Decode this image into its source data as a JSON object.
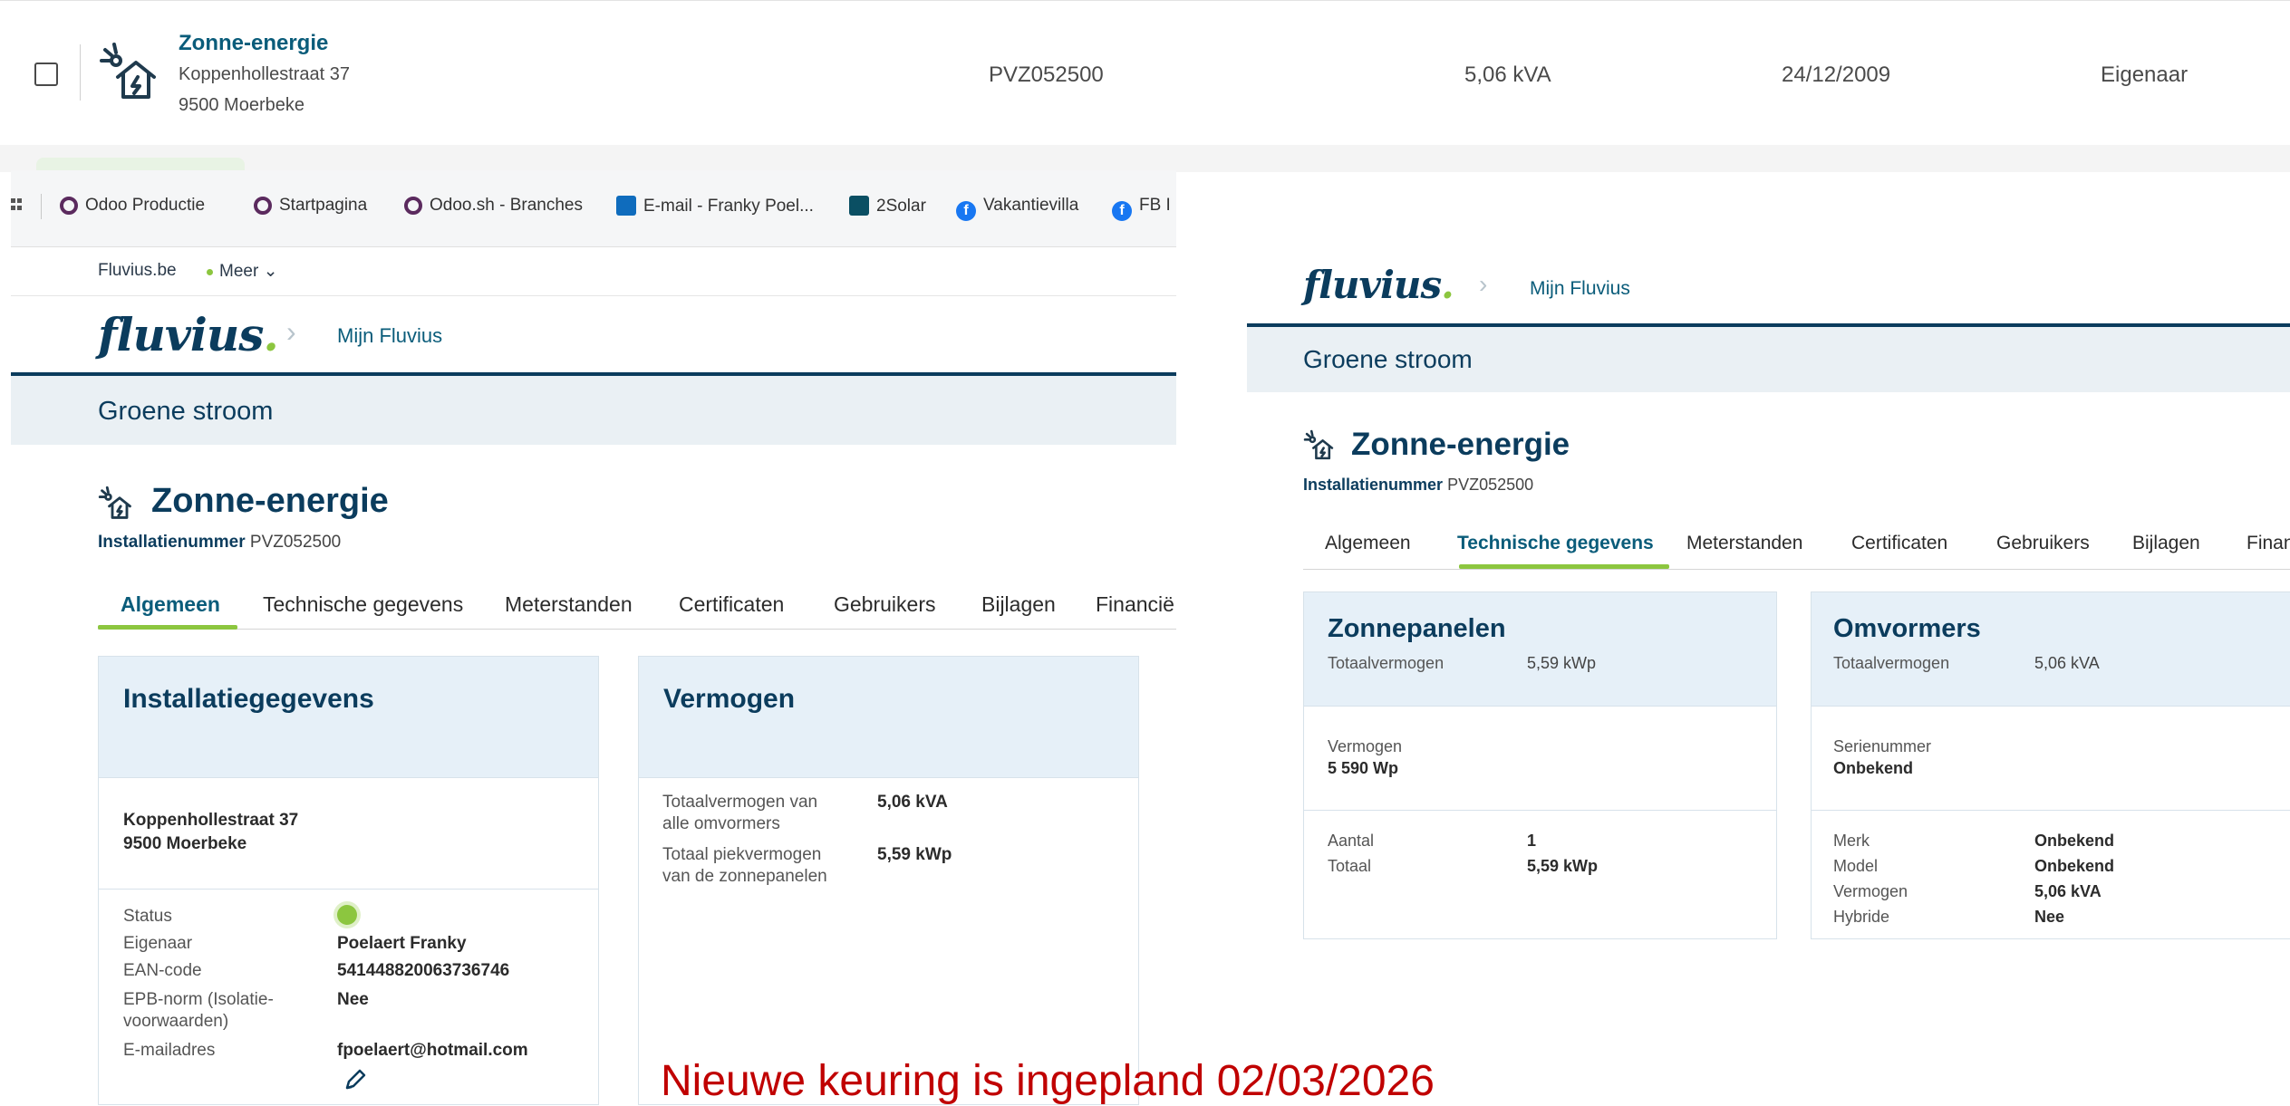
{
  "top_row": {
    "name": "Zonne-energie",
    "address_line1": "Koppenhollestraat 37",
    "address_line2": "9500 Moerbeke",
    "installation_number": "PVZ052500",
    "power": "5,06 kVA",
    "date": "24/12/2009",
    "role": "Eigenaar"
  },
  "left": {
    "bookmarks": [
      {
        "label": "Odoo Productie",
        "icon": "odoo-icon"
      },
      {
        "label": "Startpagina",
        "icon": "odoo-icon"
      },
      {
        "label": "Odoo.sh - Branches",
        "icon": "odoo-icon"
      },
      {
        "label": "E-mail - Franky Poel...",
        "icon": "outlook-icon"
      },
      {
        "label": "2Solar",
        "icon": "2solar-icon"
      },
      {
        "label": "Vakantievilla",
        "icon": "facebook-icon"
      },
      {
        "label": "FB I",
        "icon": "facebook-icon"
      }
    ],
    "utility": {
      "site": "Fluvius.be",
      "more": "Meer"
    },
    "logo": "fluvius",
    "logo_dot": ".",
    "breadcrumb": "Mijn Fluvius",
    "band_title": "Groene stroom",
    "page_title": "Zonne-energie",
    "install_label": "Installatienummer",
    "install_value": "PVZ052500",
    "tabs": [
      "Algemeen",
      "Technische gegevens",
      "Meterstanden",
      "Certificaten",
      "Gebruikers",
      "Bijlagen",
      "Financië"
    ],
    "active_tab": "Algemeen",
    "install_card": {
      "title": "Installatiegegevens",
      "address_line1": "Koppenhollestraat 37",
      "address_line2": "9500 Moerbeke",
      "rows": [
        {
          "label": "Status",
          "value": ""
        },
        {
          "label": "Eigenaar",
          "value": "Poelaert Franky"
        },
        {
          "label": "EAN-code",
          "value": "541448820063736746"
        },
        {
          "label": "EPB-norm (Isolatie-",
          "label2": "voorwaarden)",
          "value": "Nee"
        },
        {
          "label": "E-mailadres",
          "value": "fpoelaert@hotmail.com"
        }
      ],
      "status_color": "#8cc63f"
    },
    "power_card": {
      "title": "Vermogen",
      "rows": [
        {
          "label1": "Totaalvermogen van",
          "label2": "alle omvormers",
          "value": "5,06 kVA"
        },
        {
          "label1": "Totaal piekvermogen",
          "label2": "van de zonnepanelen",
          "value": "5,59 kWp"
        }
      ]
    }
  },
  "right": {
    "logo": "fluvius",
    "logo_dot": ".",
    "breadcrumb": "Mijn Fluvius",
    "band_title": "Groene stroom",
    "page_title": "Zonne-energie",
    "install_label": "Installatienummer",
    "install_value": "PVZ052500",
    "tabs": [
      "Algemeen",
      "Technische gegevens",
      "Meterstanden",
      "Certificaten",
      "Gebruikers",
      "Bijlagen",
      "Finan"
    ],
    "active_tab": "Technische gegevens",
    "panels_card": {
      "title": "Zonnepanelen",
      "total_label": "Totaalvermogen",
      "total_value": "5,59 kWp",
      "power_label": "Vermogen",
      "power_value": "5 590 Wp",
      "count_label": "Aantal",
      "count_value": "1",
      "sum_label": "Totaal",
      "sum_value": "5,59 kWp"
    },
    "inverters_card": {
      "title": "Omvormers",
      "total_label": "Totaalvermogen",
      "total_value": "5,06 kVA",
      "serial_label": "Serienummer",
      "serial_value": "Onbekend",
      "rows": [
        {
          "label": "Merk",
          "value": "Onbekend"
        },
        {
          "label": "Model",
          "value": "Onbekend"
        },
        {
          "label": "Vermogen",
          "value": "5,06 kVA"
        },
        {
          "label": "Hybride",
          "value": "Nee"
        }
      ]
    }
  },
  "note": "Nieuwe keuring is ingepland 02/03/2026",
  "colors": {
    "brand": "#0b3c5d",
    "accent": "#8cc63f",
    "link": "#0a5c7a",
    "note": "#c00000"
  }
}
